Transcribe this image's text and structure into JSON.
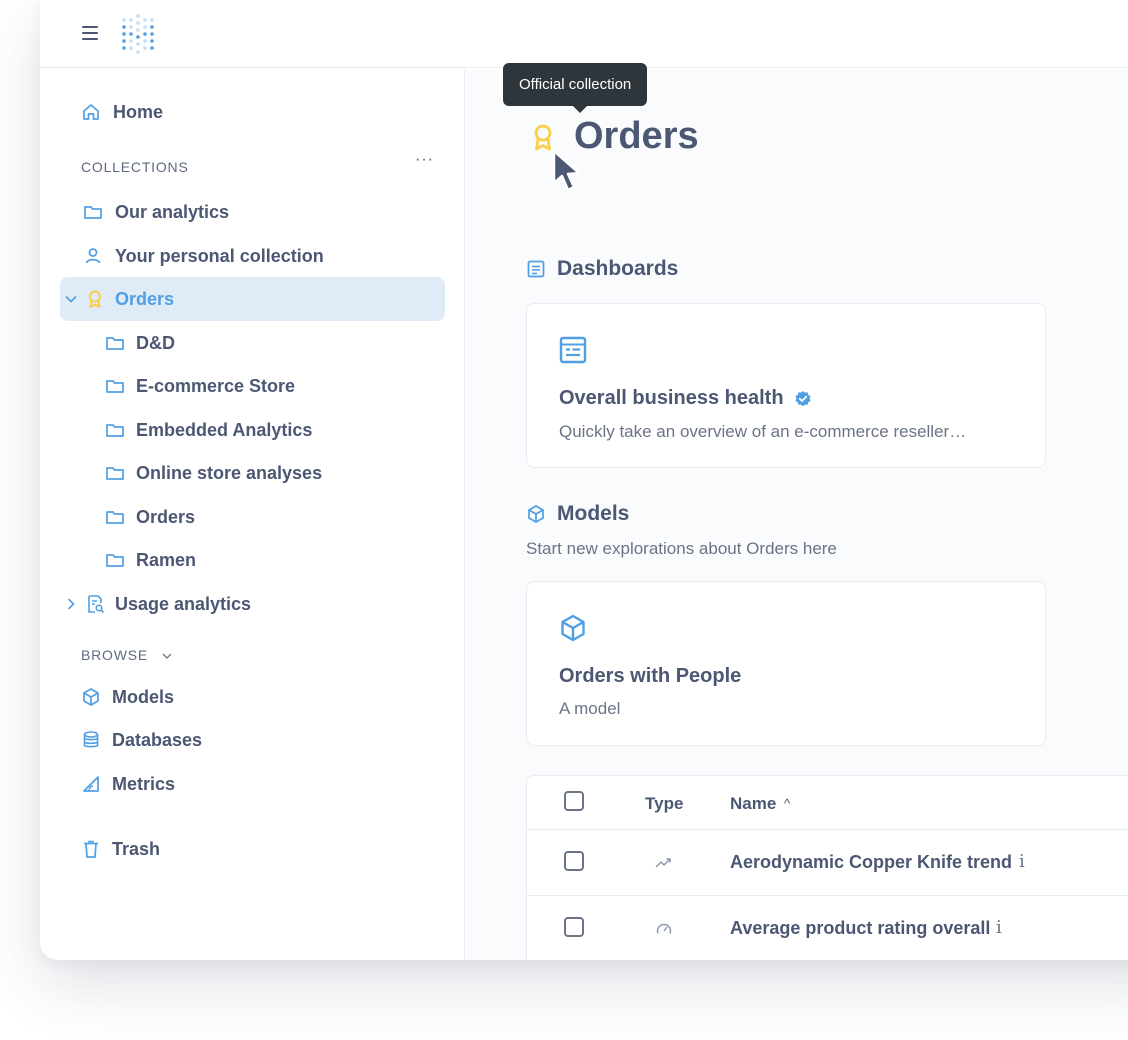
{
  "sidebar": {
    "home": "Home",
    "collections_label": "COLLECTIONS",
    "more": "···",
    "items": {
      "our_analytics": "Our analytics",
      "personal": "Your personal collection",
      "orders": "Orders",
      "dnd": "D&D",
      "ecommerce": "E-commerce Store",
      "embedded": "Embedded Analytics",
      "online_store": "Online store analyses",
      "orders_sub": "Orders",
      "ramen": "Ramen",
      "usage": "Usage analytics"
    },
    "browse_label": "BROWSE",
    "browse": {
      "models": "Models",
      "databases": "Databases",
      "metrics": "Metrics"
    },
    "trash": "Trash"
  },
  "main": {
    "tooltip": "Official collection",
    "title": "Orders",
    "dashboards_heading": "Dashboards",
    "dashboard_card": {
      "title": "Overall business health",
      "description": "Quickly take an overview of an e-commerce reseller…"
    },
    "models_heading": "Models",
    "models_subtitle": "Start new explorations about Orders here",
    "model_card": {
      "title": "Orders with People",
      "description": "A model"
    },
    "table": {
      "col_type": "Type",
      "col_name": "Name",
      "sort_indicator": "^",
      "rows": [
        {
          "name": "Aerodynamic Copper Knife trend",
          "type_icon": "trend-icon"
        },
        {
          "name": "Average product rating overall",
          "type_icon": "gauge-icon"
        }
      ]
    }
  },
  "colors": {
    "brand": "#509ee3",
    "official": "#f9cf48",
    "text": "#4c5773",
    "selected_bg": "#dfebf7",
    "tooltip_bg": "#2e353b"
  }
}
